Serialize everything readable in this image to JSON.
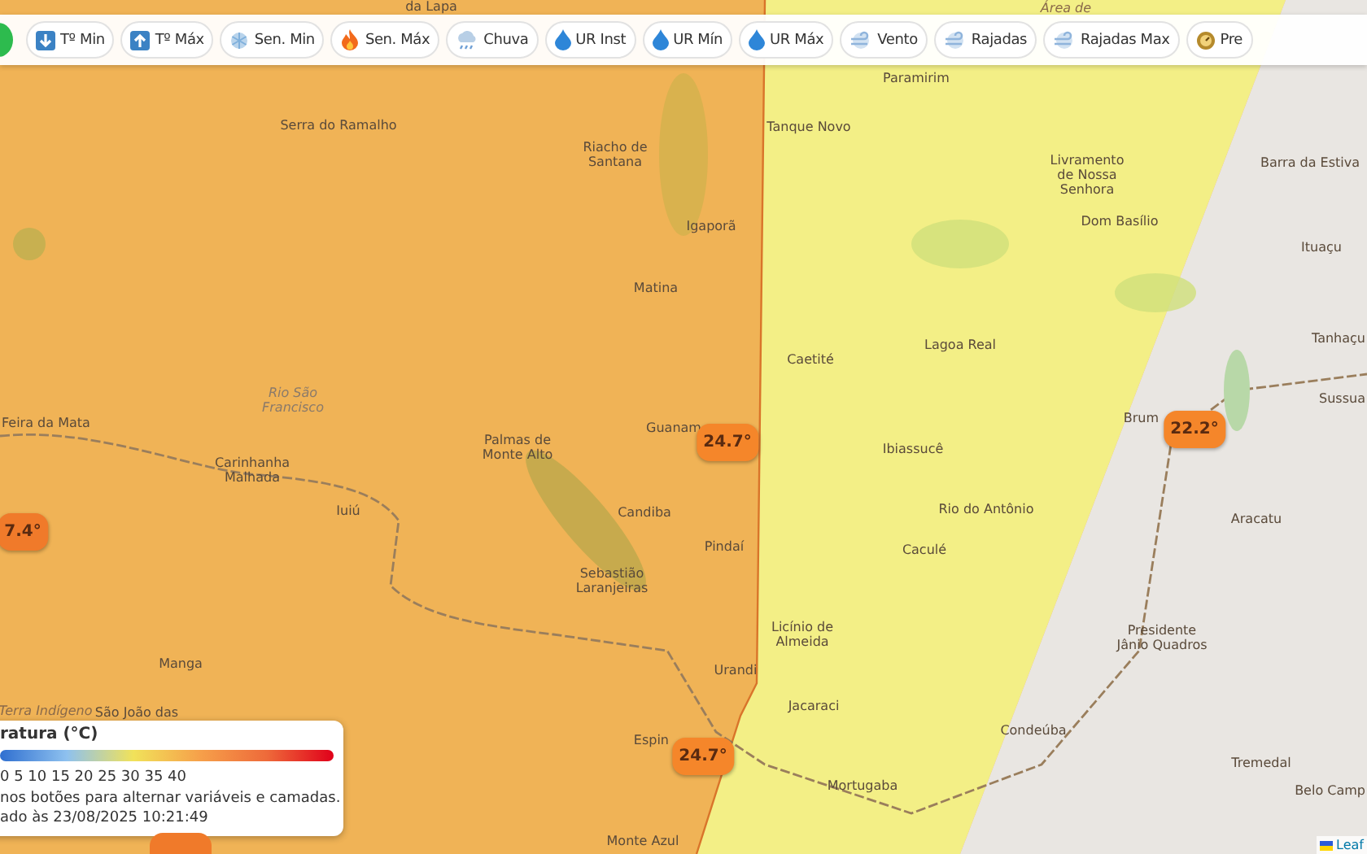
{
  "toolbar": {
    "buttons": [
      {
        "kind": "temp-min",
        "label": "Tº Min",
        "selected": false
      },
      {
        "kind": "temp-max",
        "label": "Tº Máx",
        "selected": false
      },
      {
        "kind": "cold",
        "label": "Sen. Min",
        "selected": false
      },
      {
        "kind": "fire",
        "label": "Sen. Máx",
        "selected": false
      },
      {
        "kind": "rain",
        "label": "Chuva",
        "selected": false
      },
      {
        "kind": "drop",
        "label": "UR Inst",
        "selected": false
      },
      {
        "kind": "drop",
        "label": "UR Mín",
        "selected": false
      },
      {
        "kind": "drop",
        "label": "UR Máx",
        "selected": false
      },
      {
        "kind": "wind",
        "label": "Vento",
        "selected": false
      },
      {
        "kind": "wind",
        "label": "Rajadas",
        "selected": false
      },
      {
        "kind": "wind",
        "label": "Rajadas Max",
        "selected": false
      },
      {
        "kind": "gauge",
        "label": "Pre",
        "selected": false
      }
    ]
  },
  "map": {
    "places": [
      {
        "name": "da Lapa",
        "kind": "town"
      },
      {
        "name": "Área de",
        "kind": "area"
      },
      {
        "name": "Paramirim",
        "kind": "town"
      },
      {
        "name": "Serra do Ramalho",
        "kind": "town"
      },
      {
        "name": "Tanque Novo",
        "kind": "town"
      },
      {
        "name": "Riacho de\nSantana",
        "kind": "town"
      },
      {
        "name": "Livramento\nde Nossa\nSenhora",
        "kind": "town"
      },
      {
        "name": "Barra da Estiva",
        "kind": "town"
      },
      {
        "name": "Igaporã",
        "kind": "town"
      },
      {
        "name": "Dom Basílio",
        "kind": "town"
      },
      {
        "name": "Ituaçu",
        "kind": "town"
      },
      {
        "name": "Matina",
        "kind": "town"
      },
      {
        "name": "Caetité",
        "kind": "town"
      },
      {
        "name": "Lagoa Real",
        "kind": "town"
      },
      {
        "name": "Tanhaçu",
        "kind": "town"
      },
      {
        "name": "Feira da Mata",
        "kind": "town"
      },
      {
        "name": "Rio São\nFrancisco",
        "kind": "river"
      },
      {
        "name": "Guanam",
        "kind": "town"
      },
      {
        "name": "Brum",
        "kind": "town"
      },
      {
        "name": "Sussua",
        "kind": "town"
      },
      {
        "name": "Carinhanha\nMalhada",
        "kind": "town"
      },
      {
        "name": "Palmas de\nMonte Alto",
        "kind": "town"
      },
      {
        "name": "Ibiassucê",
        "kind": "town"
      },
      {
        "name": "Iuiú",
        "kind": "town"
      },
      {
        "name": "Candiba",
        "kind": "town"
      },
      {
        "name": "Rio do Antônio",
        "kind": "town"
      },
      {
        "name": "Aracatu",
        "kind": "town"
      },
      {
        "name": "Pindaí",
        "kind": "town"
      },
      {
        "name": "Caculé",
        "kind": "town"
      },
      {
        "name": "Sebastião\nLaranjeiras",
        "kind": "town"
      },
      {
        "name": "Licínio de\nAlmeida",
        "kind": "town"
      },
      {
        "name": "Presidente\nJânio Quadros",
        "kind": "town"
      },
      {
        "name": "Manga",
        "kind": "town"
      },
      {
        "name": "Urandi",
        "kind": "town"
      },
      {
        "name": "Terra Indígeno",
        "kind": "area"
      },
      {
        "name": "São João das",
        "kind": "town"
      },
      {
        "name": "Jacaraci",
        "kind": "town"
      },
      {
        "name": "Condeúba",
        "kind": "town"
      },
      {
        "name": "Espin",
        "kind": "town"
      },
      {
        "name": "Tremedal",
        "kind": "town"
      },
      {
        "name": "Mortugaba",
        "kind": "town"
      },
      {
        "name": "Belo Camp",
        "kind": "town"
      },
      {
        "name": "Monte Azul",
        "kind": "town"
      }
    ],
    "markers": [
      {
        "reading": "24.7°",
        "color": "#f5862a"
      },
      {
        "reading": "22.2°",
        "color": "#f5862a"
      },
      {
        "reading": "7.4°",
        "color": "#f07a2a"
      },
      {
        "reading": "24.7°",
        "color": "#f5862a"
      }
    ],
    "attribution": "Leaf"
  },
  "legend": {
    "title": "ratura (°C)",
    "scale": "0 5 10 15 20 25 30 35 40",
    "hint": "nos botões para alternar variáveis e camadas.",
    "updated": "ado às 23/08/2025 10:21:49"
  }
}
